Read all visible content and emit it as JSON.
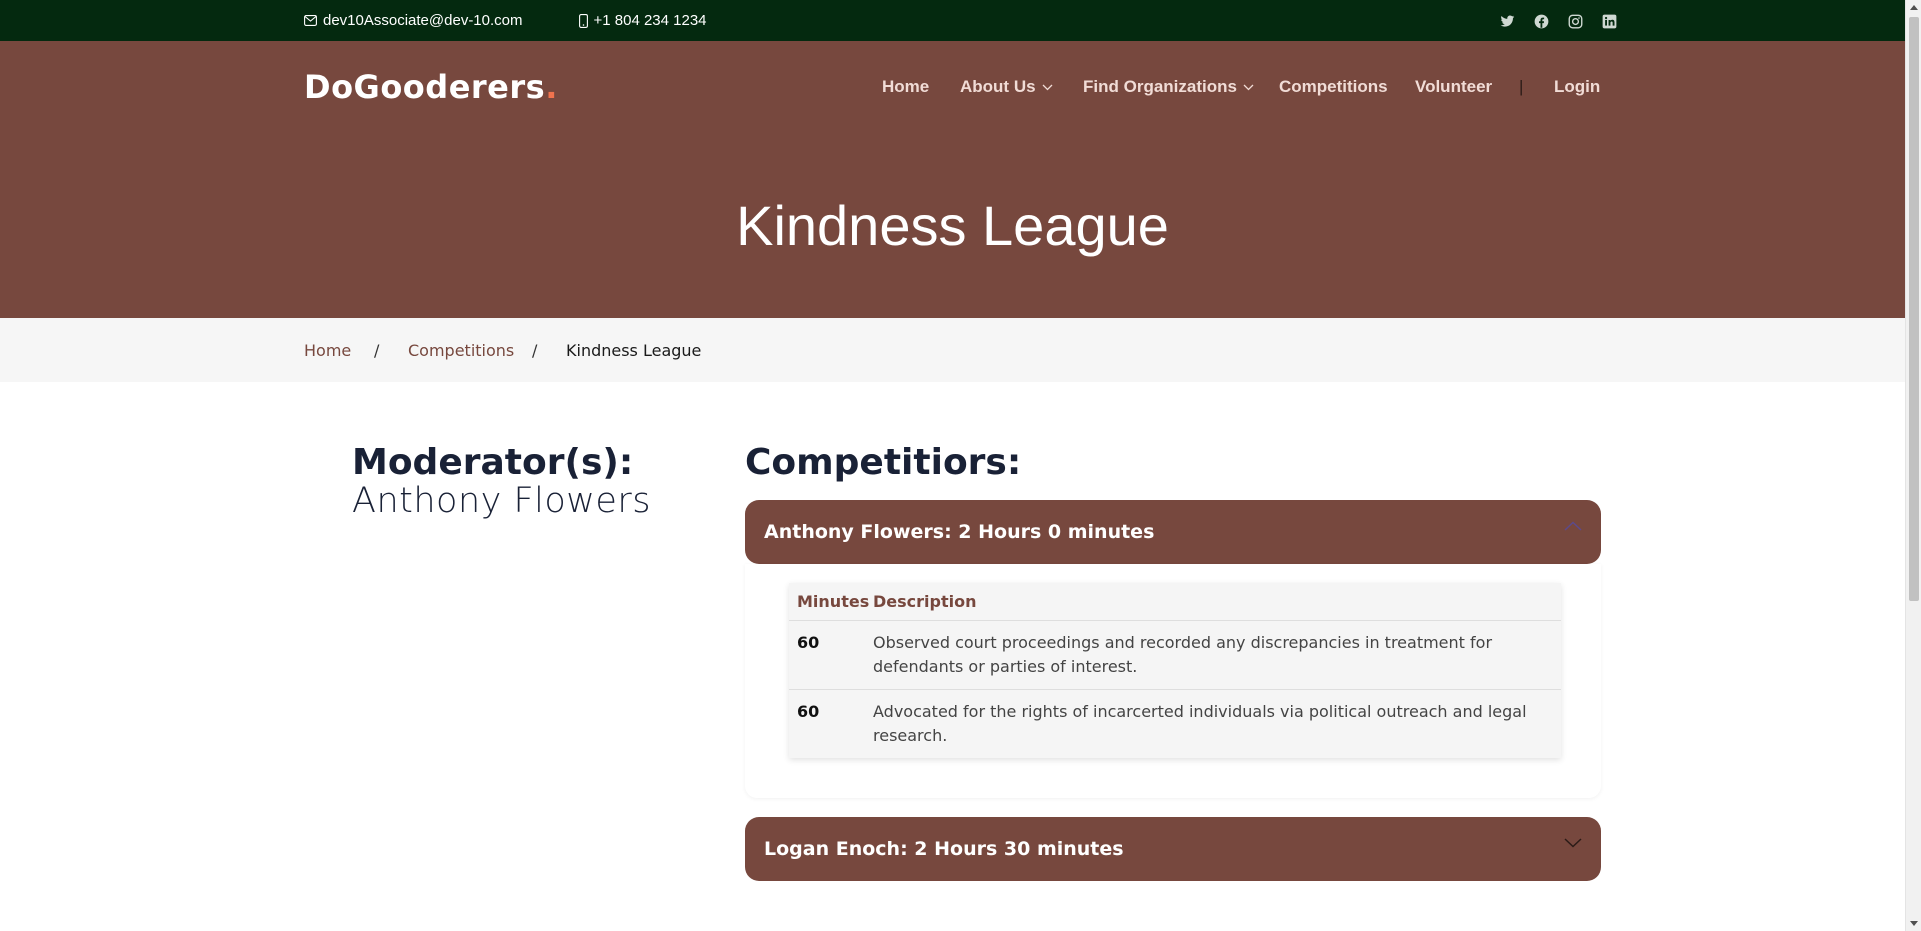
{
  "topbar": {
    "email": "dev10Associate@dev-10.com",
    "phone": "+1 804 234 1234",
    "email_icon": "envelope-icon",
    "phone_icon": "phone-icon",
    "social": [
      "twitter-icon",
      "facebook-icon",
      "instagram-icon",
      "linkedin-icon"
    ]
  },
  "brand": {
    "name": "DoGooderers",
    "dot": ".",
    "dot_color": "#f0734e"
  },
  "nav": {
    "home": "Home",
    "about": "About Us",
    "find_orgs": "Find Organizations",
    "competitions": "Competitions",
    "volunteer": "Volunteer",
    "separator": "|",
    "login": "Login"
  },
  "hero": {
    "title": "Kindness League"
  },
  "breadcrumb": {
    "home": "Home",
    "sep": "/",
    "competitions": "Competitions",
    "current": "Kindness League"
  },
  "moderators": {
    "label": "Moderator(s):",
    "names": [
      "Anthony Flowers"
    ]
  },
  "competitors": {
    "label": "Competitiors:",
    "items": [
      {
        "title": "Anthony Flowers: 2 Hours 0 minutes",
        "expanded": true,
        "table": {
          "headers": [
            "Minutes",
            "Description"
          ],
          "rows": [
            {
              "minutes": "60",
              "description": "Observed court proceedings and recorded any discrepancies in treatment for defendants or parties of interest."
            },
            {
              "minutes": "60",
              "description": "Advocated for the rights of incarcerted individuals via political outreach and legal research."
            }
          ]
        }
      },
      {
        "title": "Logan Enoch: 2 Hours 30 minutes",
        "expanded": false
      }
    ]
  },
  "colors": {
    "topbar": "#04290f",
    "brand_brown": "#77483e",
    "heading": "#192136"
  }
}
